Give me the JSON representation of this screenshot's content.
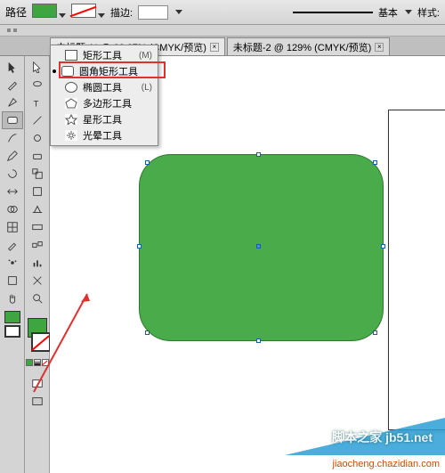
{
  "topbar": {
    "path_label": "路径",
    "fill_color": "#3fa540",
    "stroke_label": "描边:",
    "weight_label": "基本",
    "style_label": "样式:"
  },
  "tabs": [
    {
      "label": "未标题-1* @ 66.67% (CMYK/预览)",
      "active": true
    },
    {
      "label": "未标题-2 @ 129% (CMYK/预览)",
      "active": false
    }
  ],
  "flyout": {
    "items": [
      {
        "label": "矩形工具",
        "shortcut": "(M)",
        "icon": "rect",
        "selected": false
      },
      {
        "label": "圆角矩形工具",
        "shortcut": "",
        "icon": "rounded-rect",
        "selected": true
      },
      {
        "label": "椭圆工具",
        "shortcut": "(L)",
        "icon": "ellipse",
        "selected": false
      },
      {
        "label": "多边形工具",
        "shortcut": "",
        "icon": "polygon",
        "selected": false
      },
      {
        "label": "星形工具",
        "shortcut": "",
        "icon": "star",
        "selected": false
      },
      {
        "label": "光晕工具",
        "shortcut": "",
        "icon": "flare",
        "selected": false
      }
    ]
  },
  "colors": {
    "fill": "#3fa540",
    "stroke": "none",
    "shape_fill": "#4aab4a"
  },
  "watermark": {
    "line1": "脚本之家 jb51.net",
    "line2": "jiaocheng.chazidian.com"
  }
}
